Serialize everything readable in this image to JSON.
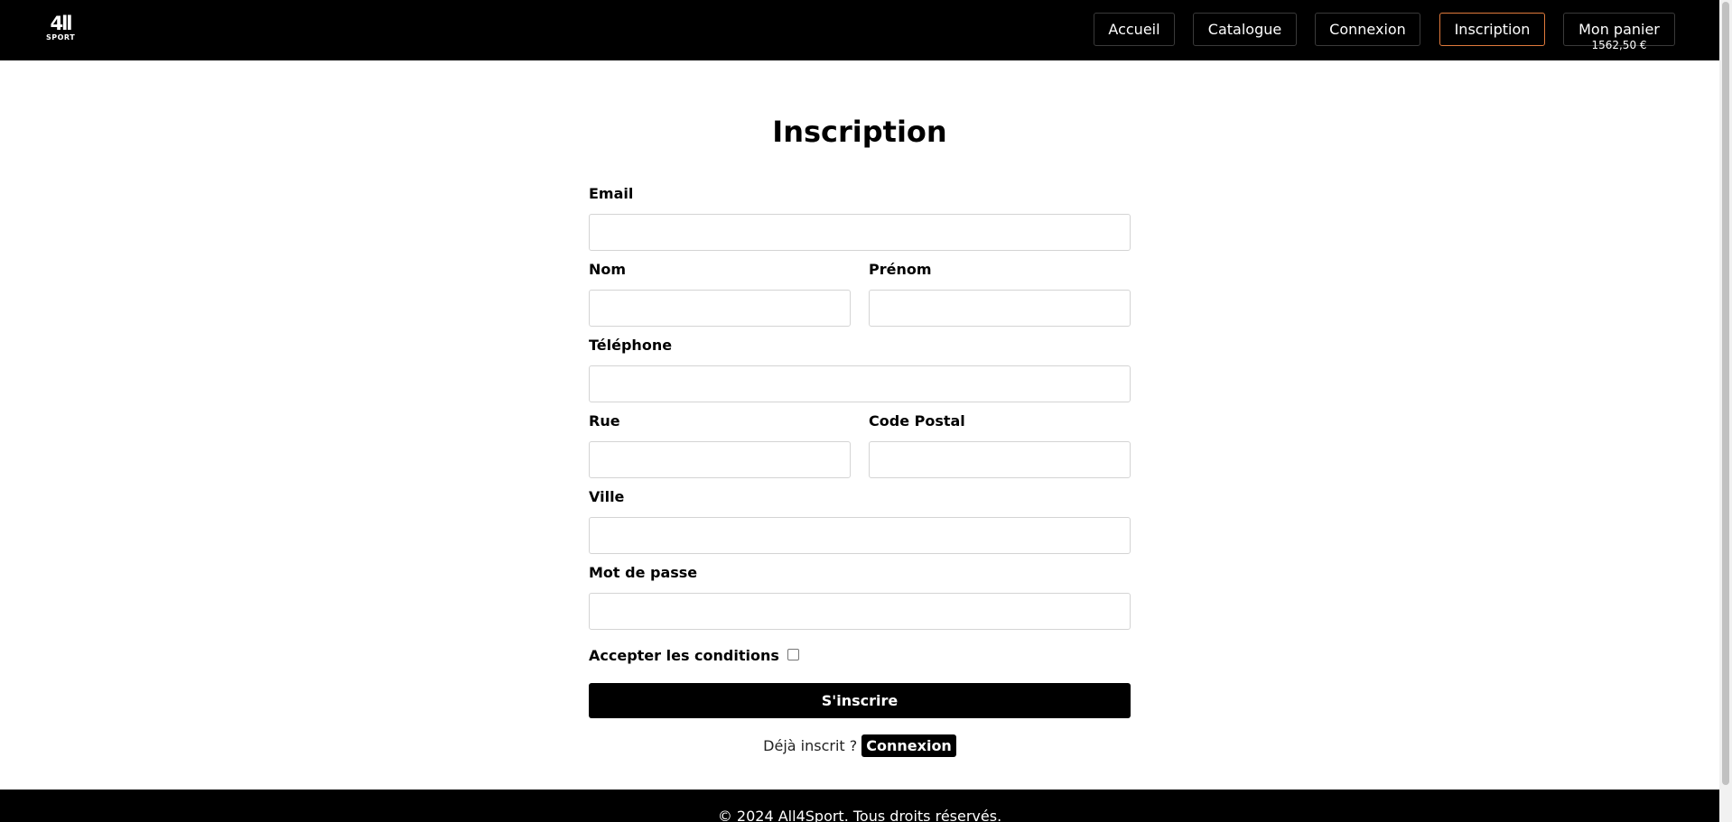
{
  "header": {
    "logo": {
      "main": "4ll",
      "sub": "SPORT"
    },
    "nav": {
      "accueil": "Accueil",
      "catalogue": "Catalogue",
      "connexion": "Connexion",
      "inscription": "Inscription",
      "panier": "Mon panier"
    },
    "cart_total": "1562,50 €",
    "active_color": "#e07a3c"
  },
  "main": {
    "title": "Inscription",
    "form": {
      "email_label": "Email",
      "nom_label": "Nom",
      "prenom_label": "Prénom",
      "telephone_label": "Téléphone",
      "rue_label": "Rue",
      "code_postal_label": "Code Postal",
      "ville_label": "Ville",
      "password_label": "Mot de passe",
      "email_value": "",
      "nom_value": "",
      "prenom_value": "",
      "telephone_value": "",
      "rue_value": "",
      "code_postal_value": "",
      "ville_value": "",
      "password_value": "",
      "terms_label": "Accepter les conditions",
      "terms_checked": false,
      "submit_label": "S'inscrire"
    },
    "already_text": "Déjà inscrit ?",
    "login_link": "Connexion"
  },
  "footer": {
    "text": "© 2024 All4Sport. Tous droits réservés."
  }
}
